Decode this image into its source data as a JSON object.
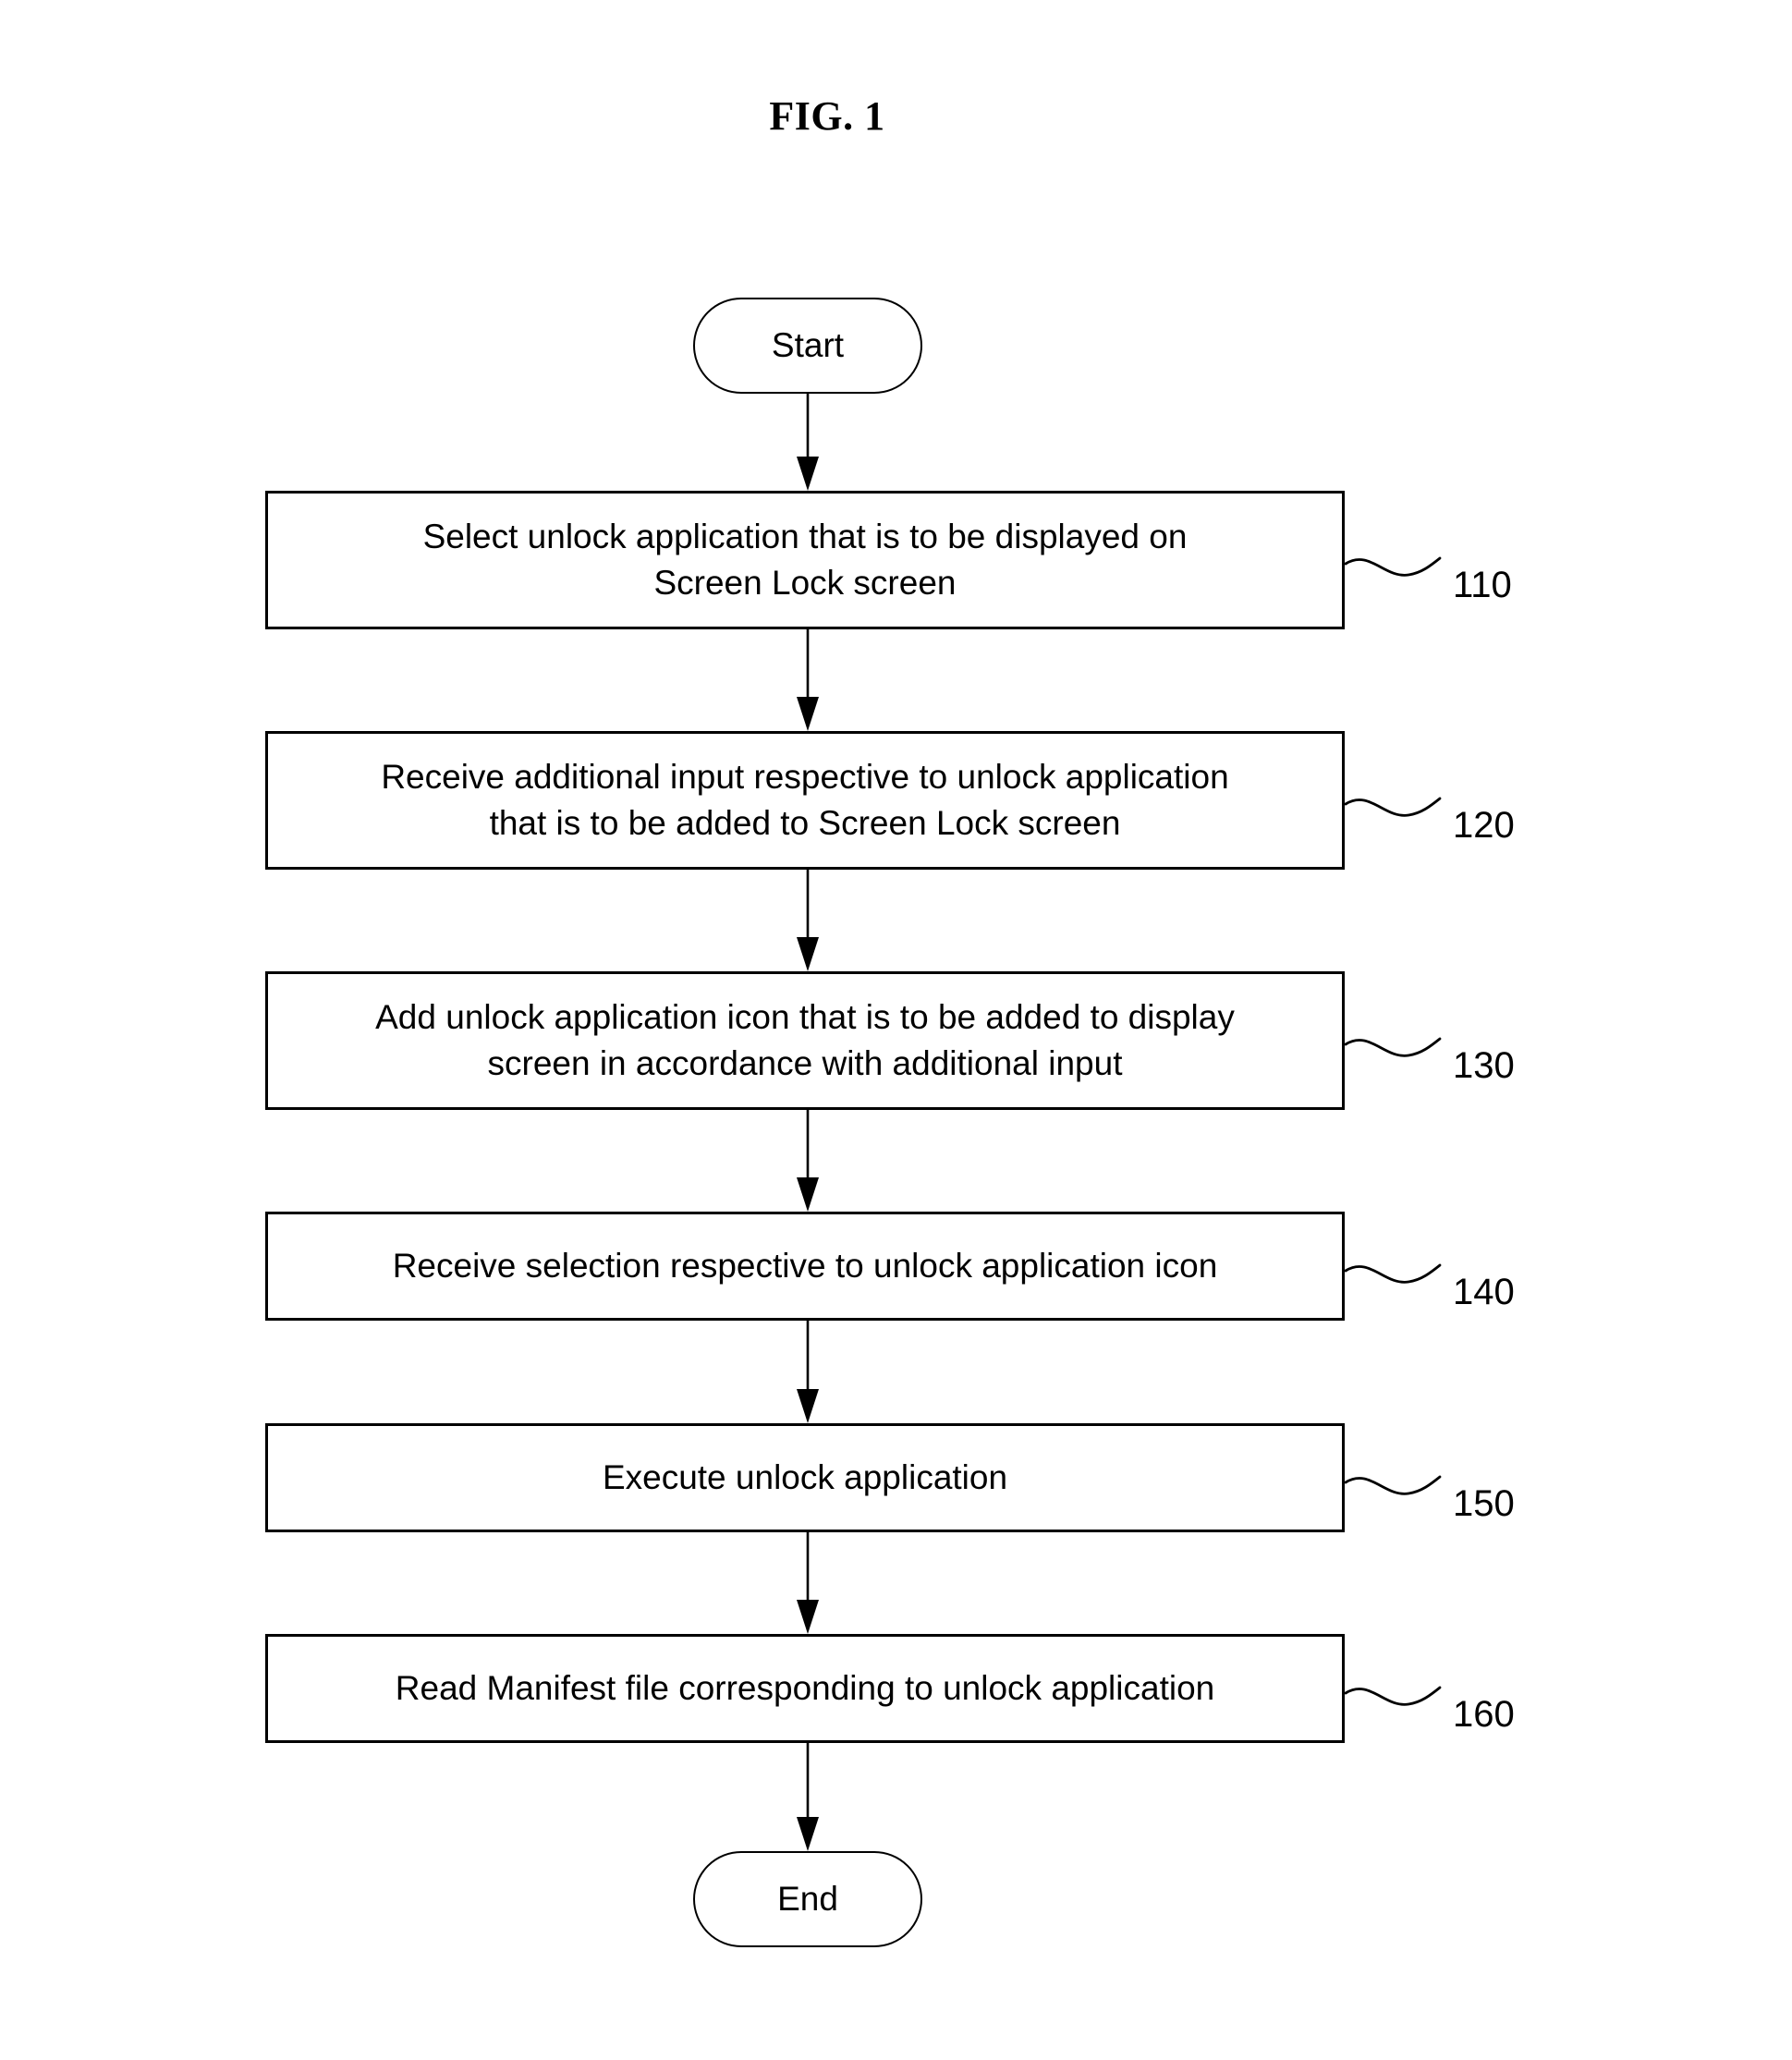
{
  "figure": {
    "title": "FIG. 1",
    "type": "flowchart"
  },
  "nodes": {
    "start": {
      "label": "Start",
      "shape": "terminal"
    },
    "end": {
      "label": "End",
      "shape": "terminal"
    }
  },
  "steps": [
    {
      "ref": "110",
      "shape": "process",
      "lines": [
        "Select unlock application that is to be displayed on",
        "Screen Lock screen"
      ],
      "text": "Select unlock application that is to be displayed on Screen Lock screen"
    },
    {
      "ref": "120",
      "shape": "process",
      "lines": [
        "Receive additional input respective to unlock application",
        "that is to be added to Screen Lock screen"
      ],
      "text": "Receive additional input respective to unlock application that is to be added to Screen Lock screen"
    },
    {
      "ref": "130",
      "shape": "process",
      "lines": [
        "Add unlock application icon that is to be added to display",
        "screen in accordance with additional input"
      ],
      "text": "Add unlock application icon that is to be added to display screen in accordance with additional input"
    },
    {
      "ref": "140",
      "shape": "process",
      "lines": [
        "Receive selection respective to unlock application icon"
      ],
      "text": "Receive selection respective to unlock application icon"
    },
    {
      "ref": "150",
      "shape": "process",
      "lines": [
        "Execute unlock application"
      ],
      "text": "Execute unlock application"
    },
    {
      "ref": "160",
      "shape": "process",
      "lines": [
        "Read Manifest file corresponding to unlock application"
      ],
      "text": "Read Manifest file corresponding to unlock application"
    }
  ],
  "colors": {
    "stroke": "#000000",
    "background": "#ffffff"
  }
}
